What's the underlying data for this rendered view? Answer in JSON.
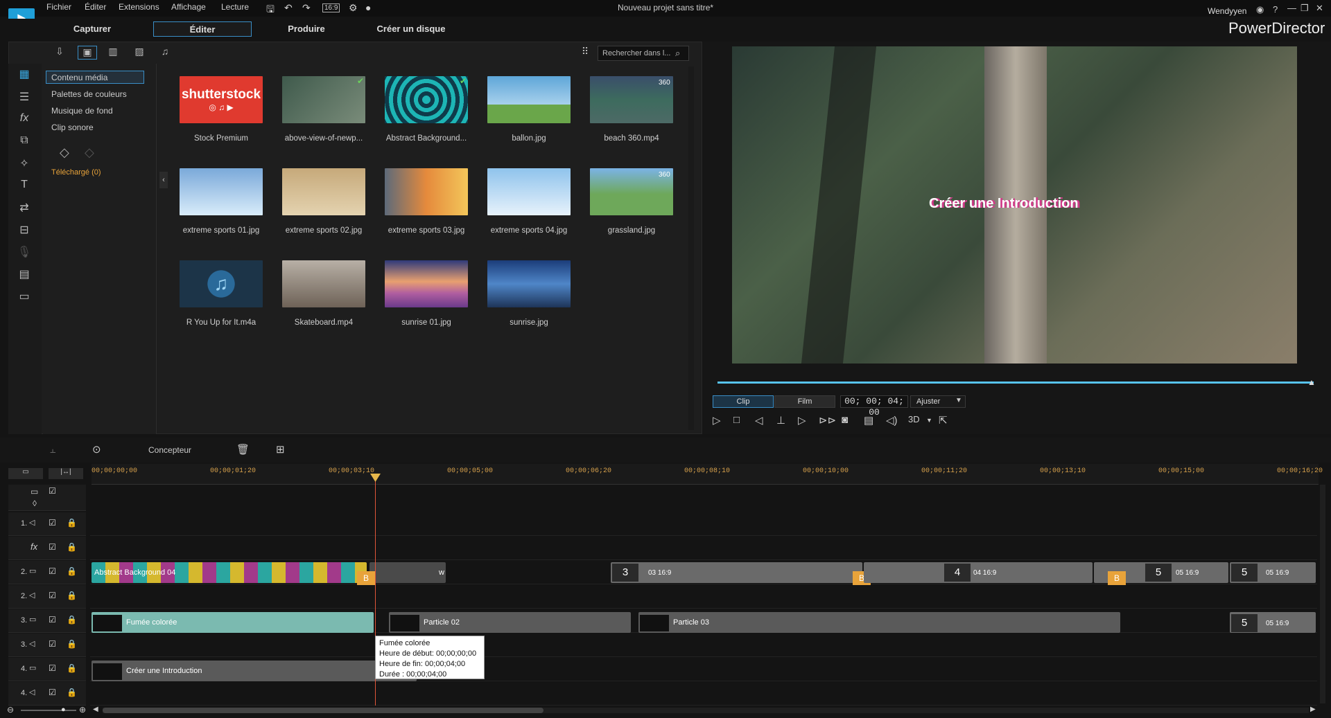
{
  "menubar": {
    "items": [
      "Fichier",
      "Éditer",
      "Extensions",
      "Affichage",
      "Lecture"
    ],
    "aspect": "16:9",
    "project_title": "Nouveau projet sans titre*",
    "user": "Wendyyen",
    "help": "?"
  },
  "modes": {
    "capture": "Capturer",
    "edit": "Éditer",
    "produce": "Produire",
    "disc": "Créer un disque"
  },
  "brand": "PowerDirector",
  "library": {
    "tree": [
      "Contenu média",
      "Palettes de couleurs",
      "Musique de fond",
      "Clip sonore"
    ],
    "downloaded": "Téléchargé  (0)",
    "search_placeholder": "Rechercher dans l...",
    "items": [
      {
        "label": "Stock Premium",
        "color": "#e03a2f"
      },
      {
        "label": "above-view-of-newp...",
        "color": "#4a6a58"
      },
      {
        "label": "Abstract Background...",
        "color": "#1db5b5"
      },
      {
        "label": "ballon.jpg",
        "color": "#5ea6d8"
      },
      {
        "label": "beach 360.mp4",
        "color": "#4d6a66"
      },
      {
        "label": "extreme sports 01.jpg",
        "color": "#7aa9d9"
      },
      {
        "label": "extreme sports 02.jpg",
        "color": "#c6a97a"
      },
      {
        "label": "extreme sports 03.jpg",
        "color": "#e58a3c"
      },
      {
        "label": "extreme sports 04.jpg",
        "color": "#8fc3ec"
      },
      {
        "label": "grassland.jpg",
        "color": "#6ea85a"
      },
      {
        "label": "R You Up for It.m4a",
        "color": "#1c3448"
      },
      {
        "label": "Skateboard.mp4",
        "color": "#9b8a78"
      },
      {
        "label": "sunrise 01.jpg",
        "color": "#b05ea0"
      },
      {
        "label": "sunrise.jpg",
        "color": "#2d5fa8"
      }
    ],
    "shutterstock_text": "shutterstock",
    "badge_360": "360"
  },
  "preview": {
    "title": "Créer une Introduction",
    "clip_tab": "Clip",
    "film_tab": "Film",
    "timecode": "00; 00; 04; 00",
    "fit": "Ajuster",
    "mode3d": "3D"
  },
  "timeline_bar": {
    "designer": "Concepteur"
  },
  "ruler": [
    "00;00;00;00",
    "00;00;01;20",
    "00;00;03;10",
    "00;00;05;00",
    "00;00;06;20",
    "00;00;08;10",
    "00;00;10;00",
    "00;00;11;20",
    "00;00;13;10",
    "00;00;15;00",
    "00;00;16;20"
  ],
  "tracks": [
    {
      "num": "1.",
      "type": "audio"
    },
    {
      "num": "",
      "type": "fx"
    },
    {
      "num": "2.",
      "type": "video"
    },
    {
      "num": "2.",
      "type": "audio"
    },
    {
      "num": "3.",
      "type": "video"
    },
    {
      "num": "3.",
      "type": "audio"
    },
    {
      "num": "4.",
      "type": "video"
    },
    {
      "num": "4.",
      "type": "audio"
    }
  ],
  "clips": {
    "abstract": "Abstract Background 04",
    "c3": "3",
    "c3r": "03 16:9",
    "c4": "4",
    "c4r": "04 16:9",
    "c5": "5",
    "c5r": "05 16:9",
    "smoke": "Fumée colorée",
    "p02": "Particle 02",
    "p03": "Particle 03",
    "intro": "Créer une Introduction",
    "b": "B",
    "w": "w"
  },
  "tooltip": {
    "name": "Fumée colorée",
    "start": "Heure de début: 00;00;00;00",
    "end": "Heure de fin: 00;00;04;00",
    "duration": "Durée : 00;00;04;00"
  }
}
